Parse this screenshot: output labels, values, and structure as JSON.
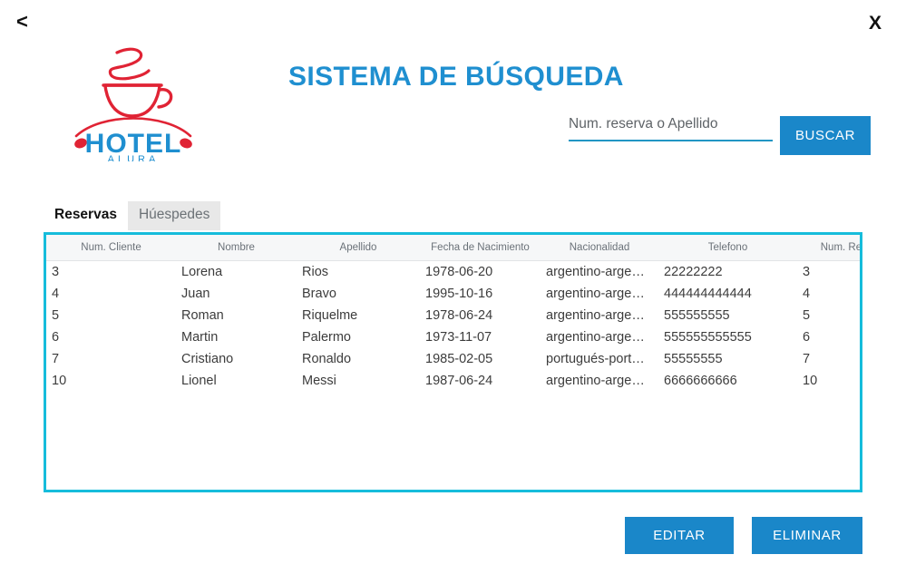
{
  "window": {
    "back_label": "<",
    "close_label": "X"
  },
  "brand": {
    "name_top": "HOTEL",
    "name_bottom": "ALURA",
    "cup_color": "#e02334",
    "text_color": "#1f8fd0"
  },
  "header": {
    "title": "SISTEMA DE BÚSQUEDA",
    "title_color": "#1f8fd0"
  },
  "search": {
    "placeholder": "Num. reserva o Apellido",
    "value": "",
    "button_label": "BUSCAR",
    "button_color": "#1a87c9"
  },
  "tabs": [
    {
      "label": "Reservas",
      "active": true
    },
    {
      "label": "Húespedes",
      "active": false
    }
  ],
  "table": {
    "border_color": "#16bcdb",
    "columns": [
      "Num. Cliente",
      "Nombre",
      "Apellido",
      "Fecha de Nacimiento",
      "Nacionalidad",
      "Telefono",
      "Num. Reserva"
    ],
    "rows": [
      {
        "num_cliente": "3",
        "nombre": "Lorena",
        "apellido": "Rios",
        "fecha_nacimiento": "1978-06-20",
        "nacionalidad": "argentino-arge…",
        "telefono": "22222222",
        "num_reserva": "3"
      },
      {
        "num_cliente": "4",
        "nombre": "Juan",
        "apellido": "Bravo",
        "fecha_nacimiento": "1995-10-16",
        "nacionalidad": "argentino-arge…",
        "telefono": "444444444444",
        "num_reserva": "4"
      },
      {
        "num_cliente": "5",
        "nombre": "Roman",
        "apellido": "Riquelme",
        "fecha_nacimiento": "1978-06-24",
        "nacionalidad": "argentino-arge…",
        "telefono": "555555555",
        "num_reserva": "5"
      },
      {
        "num_cliente": "6",
        "nombre": "Martin",
        "apellido": "Palermo",
        "fecha_nacimiento": "1973-11-07",
        "nacionalidad": "argentino-arge…",
        "telefono": "555555555555",
        "num_reserva": "6"
      },
      {
        "num_cliente": "7",
        "nombre": "Cristiano",
        "apellido": "Ronaldo",
        "fecha_nacimiento": "1985-02-05",
        "nacionalidad": "portugués-port…",
        "telefono": "55555555",
        "num_reserva": "7"
      },
      {
        "num_cliente": "10",
        "nombre": "Lionel",
        "apellido": "Messi",
        "fecha_nacimiento": "1987-06-24",
        "nacionalidad": "argentino-arge…",
        "telefono": "6666666666",
        "num_reserva": "10"
      }
    ]
  },
  "footer": {
    "edit_label": "EDITAR",
    "delete_label": "ELIMINAR"
  }
}
